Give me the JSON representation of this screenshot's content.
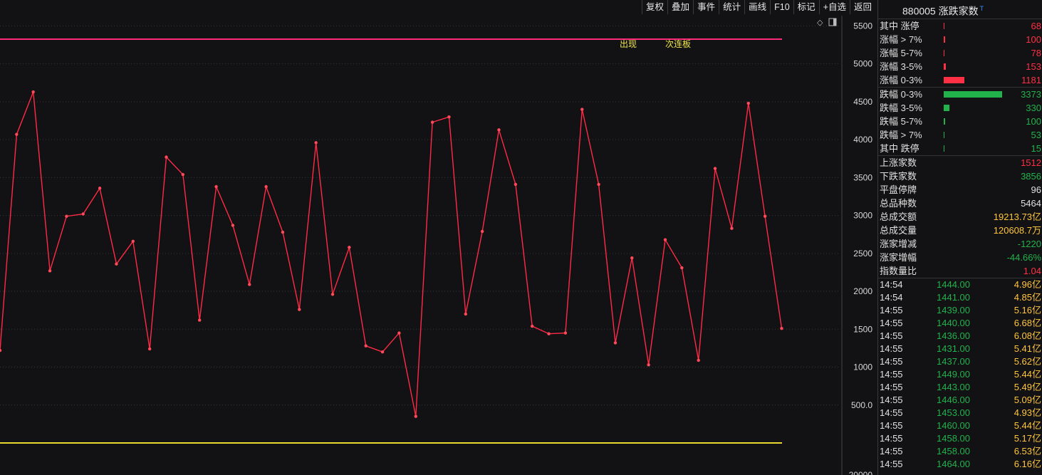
{
  "toolbar": [
    "复权",
    "叠加",
    "事件",
    "统计",
    "画线",
    "F10",
    "标记",
    "+自选",
    "返回"
  ],
  "chart_data": {
    "type": "line",
    "y_ticks": [
      "5500",
      "5000",
      "4500",
      "4000",
      "3500",
      "3000",
      "2500",
      "2000",
      "1500",
      "1000",
      "500.0"
    ],
    "bottom_tick": "20000",
    "ylim": [
      0,
      5600
    ],
    "reference_lines": {
      "top": 5350,
      "bottom": 0
    },
    "annotations": [
      "出现",
      "次连板"
    ],
    "colors": {
      "series": "#ff2a45",
      "top_line": "#ff2a7a",
      "bottom_line": "#e8d830"
    },
    "values": [
      1220,
      4070,
      4630,
      2270,
      2990,
      3020,
      3360,
      2360,
      2660,
      1240,
      3770,
      3540,
      1620,
      3380,
      2870,
      2090,
      3380,
      2780,
      1760,
      3960,
      1960,
      2580,
      1280,
      1200,
      1450,
      350,
      4230,
      4300,
      1700,
      2790,
      4130,
      3410,
      1540,
      1440,
      1450,
      4400,
      3410,
      1320,
      2440,
      1030,
      2680,
      2310,
      1090,
      3620,
      2830,
      4480,
      2990,
      1510
    ]
  },
  "panel": {
    "title": "880005 涨跌家数",
    "title_mark": "T",
    "dist": [
      {
        "label": "其中 涨停",
        "value": "68",
        "color": "red",
        "pct": 1
      },
      {
        "label": "涨幅 > 7%",
        "value": "100",
        "color": "red",
        "pct": 2
      },
      {
        "label": "涨幅 5-7%",
        "value": "78",
        "color": "red",
        "pct": 1
      },
      {
        "label": "涨幅 3-5%",
        "value": "153",
        "color": "red",
        "pct": 4
      },
      {
        "label": "涨幅 0-3%",
        "value": "1181",
        "color": "red",
        "pct": 35
      },
      {
        "label": "跌幅 0-3%",
        "value": "3373",
        "color": "grn",
        "pct": 100
      },
      {
        "label": "跌幅 3-5%",
        "value": "330",
        "color": "grn",
        "pct": 10
      },
      {
        "label": "跌幅 5-7%",
        "value": "100",
        "color": "grn",
        "pct": 3
      },
      {
        "label": "跌幅 > 7%",
        "value": "53",
        "color": "grn",
        "pct": 1
      },
      {
        "label": "其中 跌停",
        "value": "15",
        "color": "grn",
        "pct": 1
      }
    ],
    "stats": [
      {
        "label": "上涨家数",
        "value": "1512",
        "color": "red"
      },
      {
        "label": "下跌家数",
        "value": "3856",
        "color": "grn"
      },
      {
        "label": "平盘停牌",
        "value": "96",
        "color": "wht"
      },
      {
        "label": "总品种数",
        "value": "5464",
        "color": "wht"
      },
      {
        "label": "总成交额",
        "value": "19213.73亿",
        "color": "ylw"
      },
      {
        "label": "总成交量",
        "value": "120608.7万",
        "color": "ylw"
      },
      {
        "label": "涨家增减",
        "value": "-1220",
        "color": "grn"
      },
      {
        "label": "涨家增幅",
        "value": "-44.66%",
        "color": "grn"
      },
      {
        "label": "指数量比",
        "value": "1.04",
        "color": "red"
      }
    ],
    "ticks": [
      {
        "time": "14:54",
        "price": "1444.00",
        "amount": "4.96亿"
      },
      {
        "time": "14:54",
        "price": "1441.00",
        "amount": "4.85亿"
      },
      {
        "time": "14:55",
        "price": "1439.00",
        "amount": "5.16亿"
      },
      {
        "time": "14:55",
        "price": "1440.00",
        "amount": "6.68亿"
      },
      {
        "time": "14:55",
        "price": "1436.00",
        "amount": "6.08亿"
      },
      {
        "time": "14:55",
        "price": "1431.00",
        "amount": "5.41亿"
      },
      {
        "time": "14:55",
        "price": "1437.00",
        "amount": "5.62亿"
      },
      {
        "time": "14:55",
        "price": "1449.00",
        "amount": "5.44亿"
      },
      {
        "time": "14:55",
        "price": "1443.00",
        "amount": "5.49亿"
      },
      {
        "time": "14:55",
        "price": "1446.00",
        "amount": "5.09亿"
      },
      {
        "time": "14:55",
        "price": "1453.00",
        "amount": "4.93亿"
      },
      {
        "time": "14:55",
        "price": "1460.00",
        "amount": "5.44亿"
      },
      {
        "time": "14:55",
        "price": "1458.00",
        "amount": "5.17亿"
      },
      {
        "time": "14:55",
        "price": "1458.00",
        "amount": "6.53亿"
      },
      {
        "time": "14:55",
        "price": "1464.00",
        "amount": "6.16亿"
      }
    ]
  }
}
